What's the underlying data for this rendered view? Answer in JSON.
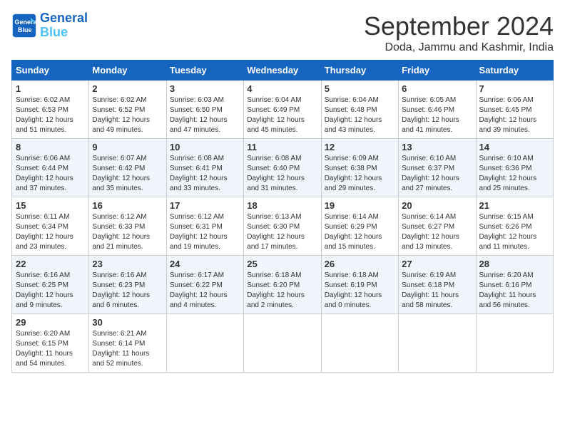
{
  "header": {
    "logo_line1": "General",
    "logo_line2": "Blue",
    "month_title": "September 2024",
    "location": "Doda, Jammu and Kashmir, India"
  },
  "days_of_week": [
    "Sunday",
    "Monday",
    "Tuesday",
    "Wednesday",
    "Thursday",
    "Friday",
    "Saturday"
  ],
  "weeks": [
    [
      {
        "day": "1",
        "info": "Sunrise: 6:02 AM\nSunset: 6:53 PM\nDaylight: 12 hours\nand 51 minutes."
      },
      {
        "day": "2",
        "info": "Sunrise: 6:02 AM\nSunset: 6:52 PM\nDaylight: 12 hours\nand 49 minutes."
      },
      {
        "day": "3",
        "info": "Sunrise: 6:03 AM\nSunset: 6:50 PM\nDaylight: 12 hours\nand 47 minutes."
      },
      {
        "day": "4",
        "info": "Sunrise: 6:04 AM\nSunset: 6:49 PM\nDaylight: 12 hours\nand 45 minutes."
      },
      {
        "day": "5",
        "info": "Sunrise: 6:04 AM\nSunset: 6:48 PM\nDaylight: 12 hours\nand 43 minutes."
      },
      {
        "day": "6",
        "info": "Sunrise: 6:05 AM\nSunset: 6:46 PM\nDaylight: 12 hours\nand 41 minutes."
      },
      {
        "day": "7",
        "info": "Sunrise: 6:06 AM\nSunset: 6:45 PM\nDaylight: 12 hours\nand 39 minutes."
      }
    ],
    [
      {
        "day": "8",
        "info": "Sunrise: 6:06 AM\nSunset: 6:44 PM\nDaylight: 12 hours\nand 37 minutes."
      },
      {
        "day": "9",
        "info": "Sunrise: 6:07 AM\nSunset: 6:42 PM\nDaylight: 12 hours\nand 35 minutes."
      },
      {
        "day": "10",
        "info": "Sunrise: 6:08 AM\nSunset: 6:41 PM\nDaylight: 12 hours\nand 33 minutes."
      },
      {
        "day": "11",
        "info": "Sunrise: 6:08 AM\nSunset: 6:40 PM\nDaylight: 12 hours\nand 31 minutes."
      },
      {
        "day": "12",
        "info": "Sunrise: 6:09 AM\nSunset: 6:38 PM\nDaylight: 12 hours\nand 29 minutes."
      },
      {
        "day": "13",
        "info": "Sunrise: 6:10 AM\nSunset: 6:37 PM\nDaylight: 12 hours\nand 27 minutes."
      },
      {
        "day": "14",
        "info": "Sunrise: 6:10 AM\nSunset: 6:36 PM\nDaylight: 12 hours\nand 25 minutes."
      }
    ],
    [
      {
        "day": "15",
        "info": "Sunrise: 6:11 AM\nSunset: 6:34 PM\nDaylight: 12 hours\nand 23 minutes."
      },
      {
        "day": "16",
        "info": "Sunrise: 6:12 AM\nSunset: 6:33 PM\nDaylight: 12 hours\nand 21 minutes."
      },
      {
        "day": "17",
        "info": "Sunrise: 6:12 AM\nSunset: 6:31 PM\nDaylight: 12 hours\nand 19 minutes."
      },
      {
        "day": "18",
        "info": "Sunrise: 6:13 AM\nSunset: 6:30 PM\nDaylight: 12 hours\nand 17 minutes."
      },
      {
        "day": "19",
        "info": "Sunrise: 6:14 AM\nSunset: 6:29 PM\nDaylight: 12 hours\nand 15 minutes."
      },
      {
        "day": "20",
        "info": "Sunrise: 6:14 AM\nSunset: 6:27 PM\nDaylight: 12 hours\nand 13 minutes."
      },
      {
        "day": "21",
        "info": "Sunrise: 6:15 AM\nSunset: 6:26 PM\nDaylight: 12 hours\nand 11 minutes."
      }
    ],
    [
      {
        "day": "22",
        "info": "Sunrise: 6:16 AM\nSunset: 6:25 PM\nDaylight: 12 hours\nand 9 minutes."
      },
      {
        "day": "23",
        "info": "Sunrise: 6:16 AM\nSunset: 6:23 PM\nDaylight: 12 hours\nand 6 minutes."
      },
      {
        "day": "24",
        "info": "Sunrise: 6:17 AM\nSunset: 6:22 PM\nDaylight: 12 hours\nand 4 minutes."
      },
      {
        "day": "25",
        "info": "Sunrise: 6:18 AM\nSunset: 6:20 PM\nDaylight: 12 hours\nand 2 minutes."
      },
      {
        "day": "26",
        "info": "Sunrise: 6:18 AM\nSunset: 6:19 PM\nDaylight: 12 hours\nand 0 minutes."
      },
      {
        "day": "27",
        "info": "Sunrise: 6:19 AM\nSunset: 6:18 PM\nDaylight: 11 hours\nand 58 minutes."
      },
      {
        "day": "28",
        "info": "Sunrise: 6:20 AM\nSunset: 6:16 PM\nDaylight: 11 hours\nand 56 minutes."
      }
    ],
    [
      {
        "day": "29",
        "info": "Sunrise: 6:20 AM\nSunset: 6:15 PM\nDaylight: 11 hours\nand 54 minutes."
      },
      {
        "day": "30",
        "info": "Sunrise: 6:21 AM\nSunset: 6:14 PM\nDaylight: 11 hours\nand 52 minutes."
      },
      {
        "day": "",
        "info": ""
      },
      {
        "day": "",
        "info": ""
      },
      {
        "day": "",
        "info": ""
      },
      {
        "day": "",
        "info": ""
      },
      {
        "day": "",
        "info": ""
      }
    ]
  ]
}
